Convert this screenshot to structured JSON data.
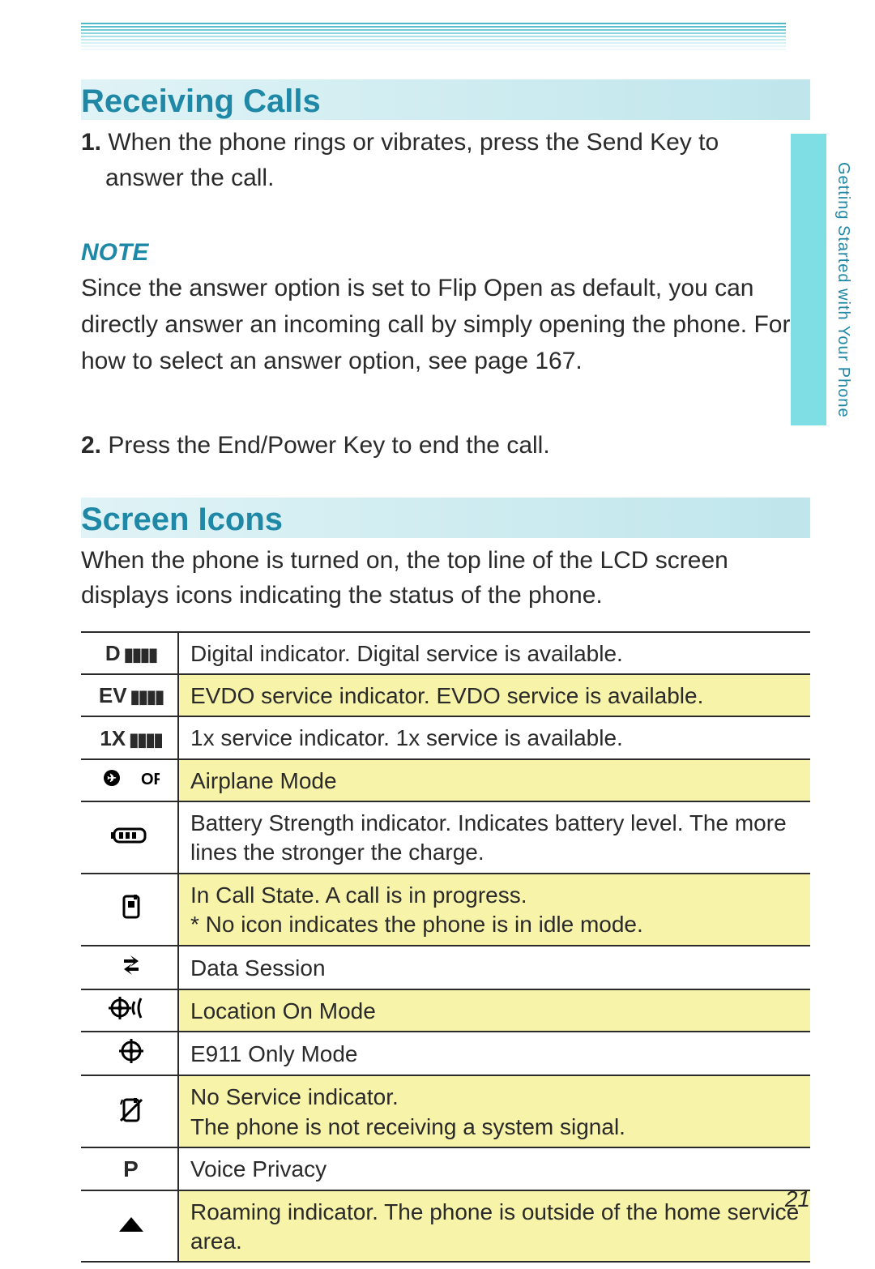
{
  "side_label": "Getting Started with Your Phone",
  "page_number": "21",
  "sections": {
    "receiving": {
      "title": "Receiving Calls",
      "step1_num": "1.",
      "step1_text_a": " When the phone rings or vibrates, press the Send Key to",
      "step1_text_b": "answer the call.",
      "note_label": "NOTE",
      "note_text": "Since the answer option is set to Flip Open as default, you can directly answer an incoming call by simply opening the phone. For how to select an answer option, see page 167.",
      "step2_num": "2.",
      "step2_text": " Press the End/Power Key to end the call."
    },
    "icons": {
      "title": "Screen Icons",
      "intro": "When the phone is turned on, the top line of the LCD screen displays icons indicating the status of the phone.",
      "rows": [
        {
          "icon_text": "D",
          "icon_name": "digital-signal-icon",
          "desc": "Digital indicator. Digital service is available.",
          "hl": false,
          "bars": true
        },
        {
          "icon_text": "EV",
          "icon_name": "evdo-signal-icon",
          "desc": "EVDO service indicator. EVDO service is available.",
          "hl": true,
          "bars": true
        },
        {
          "icon_text": "1X",
          "icon_name": "onex-signal-icon",
          "desc": "1x service indicator. 1x service is available.",
          "hl": false,
          "bars": true
        },
        {
          "icon_text": "",
          "icon_name": "airplane-off-icon",
          "desc": "Airplane Mode",
          "hl": true,
          "svg": "airplane_off"
        },
        {
          "icon_text": "",
          "icon_name": "battery-icon",
          "desc": "Battery Strength indicator. Indicates battery level. The more lines the stronger the charge.",
          "hl": false,
          "svg": "battery"
        },
        {
          "icon_text": "",
          "icon_name": "in-call-icon",
          "desc": "In Call State. A call is in progress.\n* No icon indicates the phone is in idle mode.",
          "hl": true,
          "svg": "incall"
        },
        {
          "icon_text": "",
          "icon_name": "data-session-icon",
          "desc": "Data Session",
          "hl": false,
          "svg": "datasession"
        },
        {
          "icon_text": "",
          "icon_name": "location-on-icon",
          "desc": "Location On Mode",
          "hl": true,
          "svg": "location_on"
        },
        {
          "icon_text": "",
          "icon_name": "e911-icon",
          "desc": "E911 Only Mode",
          "hl": false,
          "svg": "e911"
        },
        {
          "icon_text": "",
          "icon_name": "no-service-icon",
          "desc": "No Service indicator.\nThe phone is not receiving a system signal.",
          "hl": true,
          "svg": "noservice"
        },
        {
          "icon_text": "P",
          "icon_name": "voice-privacy-icon",
          "desc": "Voice Privacy",
          "hl": false
        },
        {
          "icon_text": "",
          "icon_name": "roaming-icon",
          "desc": "Roaming indicator. The phone is outside of the home service area.",
          "hl": true,
          "svg": "roaming"
        }
      ]
    }
  },
  "svgs": {
    "airplane_off": "<svg width='70' height='26' viewBox='0 0 70 26'><circle cx='11' cy='13' r='10' fill='#000'/><text x='11' y='18' text-anchor='middle' font-size='14' fill='#fff' font-family='Arial' font-weight='bold'>✈</text><text x='47' y='21' font-size='20' fill='#000' font-family='Arial' font-weight='bold'>OFF</text></svg>",
    "battery": "<svg width='50' height='24' viewBox='0 0 50 24'><rect x='4' y='4' width='38' height='16' rx='6' ry='6' fill='none' stroke='#000' stroke-width='3'/><rect x='0' y='8' width='5' height='8' fill='#000'/><rect x='10' y='8' width='5' height='8' fill='#000'/><rect x='18' y='8' width='5' height='8' fill='#000'/><rect x='26' y='8' width='5' height='8' fill='#000'/></svg>",
    "incall": "<svg width='26' height='30' viewBox='0 0 26 30'><rect x='4' y='2' width='18' height='26' rx='3' fill='none' stroke='#000' stroke-width='3'/><rect x='9' y='8' width='8' height='8' fill='#000'/><rect x='16' y='0' width='4' height='6' fill='#000'/></svg>",
    "datasession": "<svg width='26' height='30' viewBox='0 0 26 30'><path d='M4 8 h12 l-4 -5 l10 7 l-10 7 l4 -5 h-12 z' fill='#000'/><path d='M22 22 h-12 l4 5 l-10 -7 l10 -7 l-4 5 h12 z' fill='#000'/></svg>",
    "location_on": "<svg width='56' height='28' viewBox='0 0 56 28'><circle cx='14' cy='14' r='10' fill='none' stroke='#000' stroke-width='3'/><line x1='14' y1='0' x2='14' y2='28' stroke='#000' stroke-width='3'/><line x1='0' y1='14' x2='28' y2='14' stroke='#000' stroke-width='3'/><circle cx='14' cy='14' r='3' fill='#000'/><path d='M32 6 Q28 14 32 22' fill='none' stroke='#000' stroke-width='3'/><path d='M40 2 Q34 14 40 26' fill='none' stroke='#000' stroke-width='3'/></svg>",
    "e911": "<svg width='30' height='30' viewBox='0 0 30 30'><circle cx='15' cy='15' r='11' fill='none' stroke='#000' stroke-width='3'/><line x1='15' y1='0' x2='15' y2='30' stroke='#000' stroke-width='3'/><line x1='0' y1='15' x2='30' y2='15' stroke='#000' stroke-width='3'/><circle cx='15' cy='15' r='3' fill='#000'/></svg>",
    "noservice": "<svg width='30' height='32' viewBox='0 0 30 32'><rect x='6' y='4' width='18' height='26' rx='3' fill='none' stroke='#000' stroke-width='3'/><rect x='18' y='2' width='4' height='6' fill='#000'/><line x1='2' y1='30' x2='28' y2='4' stroke='#000' stroke-width='3'/><line x1='4' y1='4' x2='2' y2='10' stroke='#000' stroke-width='2'/></svg>",
    "roaming": "<svg width='34' height='22' viewBox='0 0 34 22'><polygon points='17,2 32,20 2,20' fill='#000'/></svg>"
  }
}
